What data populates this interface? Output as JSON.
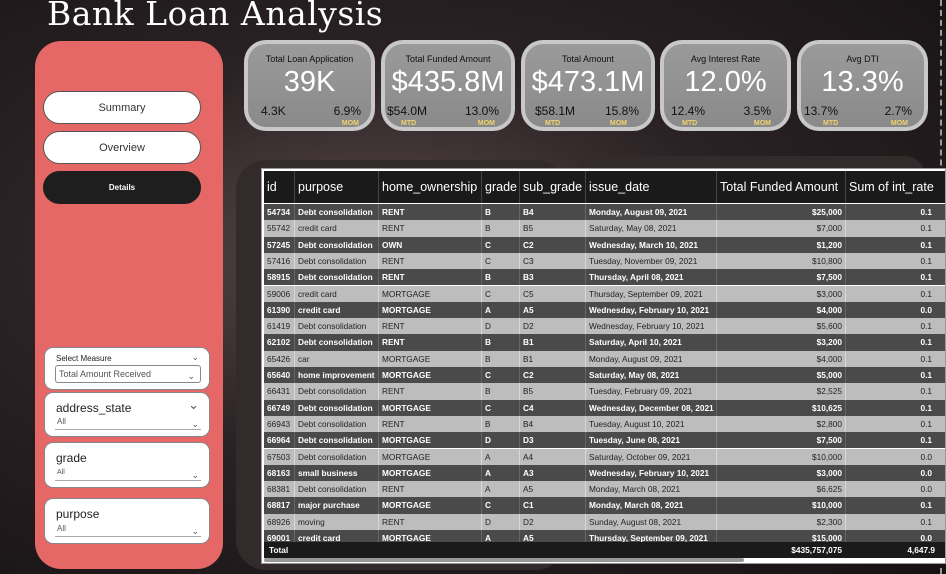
{
  "title": "Bank Loan Analysis",
  "nav": {
    "summary": "Summary",
    "overview": "Overview",
    "details": "Details"
  },
  "slicers": {
    "select_measure": {
      "title": "Select Measure",
      "value": "Total Amount Received"
    },
    "address_state": {
      "title": "address_state",
      "value": "All"
    },
    "grade": {
      "title": "grade",
      "value": "All"
    },
    "purpose": {
      "title": "purpose",
      "value": "All"
    }
  },
  "kpis": [
    {
      "title": "Total Loan Application",
      "value": "39K",
      "sub1": "4.3K",
      "sub2": "6.9%",
      "badge2": "MOM"
    },
    {
      "title": "Total Funded Amount",
      "value": "$435.8M",
      "sub1": "$54.0M",
      "sub2": "13.0%",
      "badge1": "MTD",
      "badge2": "MOM"
    },
    {
      "title": "Total  Amount",
      "value": "$473.1M",
      "sub1": "$58.1M",
      "sub2": "15.8%",
      "badge1": "MTD",
      "badge2": "MOM"
    },
    {
      "title": "Avg Interest Rate",
      "value": "12.0%",
      "sub1": "12.4%",
      "sub2": "3.5%",
      "badge1": "MTD",
      "badge2": "MOM"
    },
    {
      "title": "Avg DTI",
      "value": "13.3%",
      "sub1": "13.7%",
      "sub2": "2.7%",
      "badge1": "MTD",
      "badge2": "MOM"
    }
  ],
  "table": {
    "headers": [
      "id",
      "purpose",
      "home_ownership",
      "grade",
      "sub_grade",
      "issue_date",
      "Total Funded Amount",
      "Sum of int_rate"
    ],
    "rows": [
      [
        "54734",
        "Debt consolidation",
        "RENT",
        "B",
        "B4",
        "Monday, August 09, 2021",
        "$25,000",
        "0.1"
      ],
      [
        "55742",
        "credit card",
        "RENT",
        "B",
        "B5",
        "Saturday, May 08, 2021",
        "$7,000",
        "0.1"
      ],
      [
        "57245",
        "Debt consolidation",
        "OWN",
        "C",
        "C2",
        "Wednesday, March 10, 2021",
        "$1,200",
        "0.1"
      ],
      [
        "57416",
        "Debt consolidation",
        "RENT",
        "C",
        "C3",
        "Tuesday, November 09, 2021",
        "$10,800",
        "0.1"
      ],
      [
        "58915",
        "Debt consolidation",
        "RENT",
        "B",
        "B3",
        "Thursday, April 08, 2021",
        "$7,500",
        "0.1"
      ],
      [
        "59006",
        "credit card",
        "MORTGAGE",
        "C",
        "C5",
        "Thursday, September 09, 2021",
        "$3,000",
        "0.1"
      ],
      [
        "61390",
        "credit card",
        "MORTGAGE",
        "A",
        "A5",
        "Wednesday, February 10, 2021",
        "$4,000",
        "0.0"
      ],
      [
        "61419",
        "Debt consolidation",
        "RENT",
        "D",
        "D2",
        "Wednesday, February 10, 2021",
        "$5,600",
        "0.1"
      ],
      [
        "62102",
        "Debt consolidation",
        "RENT",
        "B",
        "B1",
        "Saturday, April 10, 2021",
        "$3,200",
        "0.1"
      ],
      [
        "65426",
        "car",
        "MORTGAGE",
        "B",
        "B1",
        "Monday, August 09, 2021",
        "$4,000",
        "0.1"
      ],
      [
        "65640",
        "home improvement",
        "MORTGAGE",
        "C",
        "C2",
        "Saturday, May 08, 2021",
        "$5,000",
        "0.1"
      ],
      [
        "66431",
        "Debt consolidation",
        "RENT",
        "B",
        "B5",
        "Tuesday, February 09, 2021",
        "$2,525",
        "0.1"
      ],
      [
        "66749",
        "Debt consolidation",
        "MORTGAGE",
        "C",
        "C4",
        "Wednesday, December 08, 2021",
        "$10,625",
        "0.1"
      ],
      [
        "66943",
        "Debt consolidation",
        "RENT",
        "B",
        "B4",
        "Tuesday, August 10, 2021",
        "$2,800",
        "0.1"
      ],
      [
        "66964",
        "Debt consolidation",
        "MORTGAGE",
        "D",
        "D3",
        "Tuesday, June 08, 2021",
        "$7,500",
        "0.1"
      ],
      [
        "67503",
        "Debt consolidation",
        "MORTGAGE",
        "A",
        "A4",
        "Saturday, October 09, 2021",
        "$10,000",
        "0.0"
      ],
      [
        "68163",
        "small business",
        "MORTGAGE",
        "A",
        "A3",
        "Wednesday, February 10, 2021",
        "$3,000",
        "0.0"
      ],
      [
        "68381",
        "Debt consolidation",
        "RENT",
        "A",
        "A5",
        "Monday, March 08, 2021",
        "$6,625",
        "0.0"
      ],
      [
        "68817",
        "major purchase",
        "MORTGAGE",
        "C",
        "C1",
        "Monday, March 08, 2021",
        "$10,000",
        "0.1"
      ],
      [
        "68926",
        "moving",
        "RENT",
        "D",
        "D2",
        "Sunday, August 08, 2021",
        "$2,300",
        "0.1"
      ],
      [
        "69001",
        "credit card",
        "MORTGAGE",
        "A",
        "A5",
        "Thursday, September 09, 2021",
        "$15,000",
        "0.0"
      ]
    ],
    "total_label": "Total",
    "total_funded": "$435,757,075",
    "total_int_rate": "4,647.9"
  }
}
